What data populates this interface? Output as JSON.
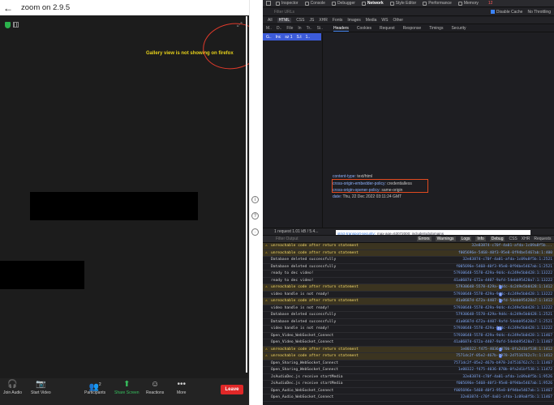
{
  "zoom": {
    "back_glyph": "←",
    "title": "zoom on 2.9.5",
    "annotation": "Gallery view is not showing on firefox",
    "expand_glyph": "⤢",
    "toolbar": [
      {
        "icon": "headphones-icon",
        "glyph": "🎧",
        "label": "Join Audio"
      },
      {
        "icon": "video-icon",
        "glyph": "📷",
        "label": "Start Video"
      },
      {
        "icon": "participants-icon",
        "glyph": "👥",
        "label": "Participants"
      },
      {
        "icon": "share-screen-icon",
        "glyph": "⬆",
        "label": "Share Screen"
      },
      {
        "icon": "reactions-icon",
        "glyph": "☺",
        "label": "Reactions"
      },
      {
        "icon": "more-icon",
        "glyph": "•••",
        "label": "More"
      }
    ],
    "participants_count": "2",
    "leave_label": "Leave"
  },
  "devtools": {
    "tabs": [
      "Inspector",
      "Console",
      "Debugger",
      "Network",
      "Style Editor",
      "Performance",
      "Memory"
    ],
    "active_tab": "Network",
    "error_count": "12",
    "filter_placeholder": "Filter URLs",
    "disable_cache_label": "Disable Cache",
    "throttling_label": "No Throttling",
    "type_filters": [
      "All",
      "HTML",
      "CSS",
      "JS",
      "XHR",
      "Fonts",
      "Images",
      "Media",
      "WS",
      "Other"
    ],
    "active_type": "HTML",
    "columns": [
      "M..",
      "D..",
      "File",
      "In",
      "Tr..",
      "Si.."
    ],
    "selected_row": [
      "G..",
      "Inc",
      "sz 1",
      "S.t",
      "1.."
    ],
    "detail_tabs": [
      "Headers",
      "Cookies",
      "Request",
      "Response",
      "Timings",
      "Security"
    ],
    "active_detail_tab": "Headers",
    "headers": [
      {
        "k": "content-type:",
        "v": "text/html"
      },
      {
        "k": "cross-origin-embedder-policy:",
        "v": "credentialless"
      },
      {
        "k": "cross-origin-opener-policy:",
        "v": "same-origin"
      },
      {
        "k": "date:",
        "v": "Thu, 22 Dec 2022 03:11:24 GMT"
      }
    ],
    "hsts": {
      "k": "strict-transport-security:",
      "v": "max-age=63072000; includeSubdomains"
    },
    "status_text": "1 request   1.01 kB / 5.4...",
    "console_filter": "Filter Output",
    "console_tabs": [
      "Errors",
      "Warnings",
      "Logs",
      "Info",
      "Debug",
      "CSS",
      "XHR",
      "Requests"
    ],
    "console_active": [
      "Errors",
      "Warnings",
      "Logs",
      "Info",
      "Debug"
    ],
    "logs": [
      {
        "warn": true,
        "text": "unreachable code after return statement",
        "count": "",
        "src": "32e83874-c70f-4a01-afda-1c09a8f5b... "
      },
      {
        "warn": true,
        "text": "unreachable code after return statement",
        "count": "",
        "src": "f005696e-5468-40f3-95e8-0f94be5467ab:1:400"
      },
      {
        "warn": false,
        "text": "Database deleted successfully",
        "count": "",
        "src": "32e83874-c70f-4a01-afda-1c09a8f5b:1:2521"
      },
      {
        "warn": false,
        "text": "Database deleted successfully",
        "count": "",
        "src": "f005696e-5468-40f3-95e8-0f94be5467ab:1:2521"
      },
      {
        "warn": false,
        "text": "ready to dec video!",
        "count": "",
        "src": "57930648-5578-429a-9d4c-4c249e5b0428:1:13222"
      },
      {
        "warn": false,
        "text": "ready to dec video!",
        "count": "",
        "src": "41a0687d-672a-4407-9afd-54ebb95420a7:1:13222"
      },
      {
        "warn": true,
        "text": "unreachable code after return statement",
        "count": "2",
        "src": "57930648-5578-429a-9d4c-4c249e5b0428:1:1412"
      },
      {
        "warn": false,
        "text": "video handle is not ready!",
        "count": "4",
        "src": "57930648-5578-429a-9d4c-4c249e5b0428:1:13222"
      },
      {
        "warn": true,
        "text": "unreachable code after return statement",
        "count": "2",
        "src": "41a0687d-672a-4407-9afd-54ebb95420a7:1:1412"
      },
      {
        "warn": false,
        "text": "video handle is not ready!",
        "count": "",
        "src": "57930648-5578-429a-9d4c-4c249e5b0428:1:13222"
      },
      {
        "warn": false,
        "text": "Database deleted successfully",
        "count": "",
        "src": "57930648-5578-429a-9d4c-4c249e5b0428:1:2521"
      },
      {
        "warn": false,
        "text": "Database deleted successfully",
        "count": "",
        "src": "41a0687d-672a-4407-9afd-54ebb95420a7:1:2521"
      },
      {
        "warn": false,
        "text": "video handle is not ready!",
        "count": "46",
        "src": "57930648-5578-429a-9d4c-4c249e5b0428:1:13222"
      },
      {
        "warn": false,
        "text": "Open_Video_WebSocket_Connect",
        "count": "",
        "src": "57930648-5578-429a-9d4c-4c249e5b0428:1:11467"
      },
      {
        "warn": false,
        "text": "Open_Video_WebSocket_Connect",
        "count": "",
        "src": "41a0687d-672a-4407-9afd-54ebb95420a7:1:11467"
      },
      {
        "warn": true,
        "text": "unreachable code after return statement",
        "count": "2",
        "src": "1e00322-f475-4036-870b-0fa2d1bf538:1:1412"
      },
      {
        "warn": true,
        "text": "unreachable code after return statement",
        "count": "2",
        "src": "7571dc2f-05e2-467b-b978-2d7516762c7c:1:1412"
      },
      {
        "warn": false,
        "text": "Open_Sharing_WebSocket_Connect",
        "count": "",
        "src": "7571dc2f-05e2-467b-b978-2d7516762c7c:1:11467"
      },
      {
        "warn": false,
        "text": "Open_Sharing_WebSocket_Connect",
        "count": "",
        "src": "1e00322-f475-4036-870b-0fa2d1bf538:1:11472"
      },
      {
        "warn": false,
        "text": "JsAudioDec.js receive startMedia",
        "count": "",
        "src": "32e83874-c70f-4a01-afda-1c09a8f5b:1:9526"
      },
      {
        "warn": false,
        "text": "JsAudioDec.js receive startMedia",
        "count": "",
        "src": "f005696e-5468-40f3-95e8-0f94be5467ab:1:9526"
      },
      {
        "warn": false,
        "text": "Open_Audio_WebSocket_Connect",
        "count": "",
        "src": "f005696e-5468-40f3-95e8-0f94be5467ab:1:11467"
      },
      {
        "warn": false,
        "text": "Open_Audio_WebSocket_Connect",
        "count": "",
        "src": "32e83874-c70f-4a01-afda-1c09a8f5b:1:11467"
      }
    ]
  }
}
